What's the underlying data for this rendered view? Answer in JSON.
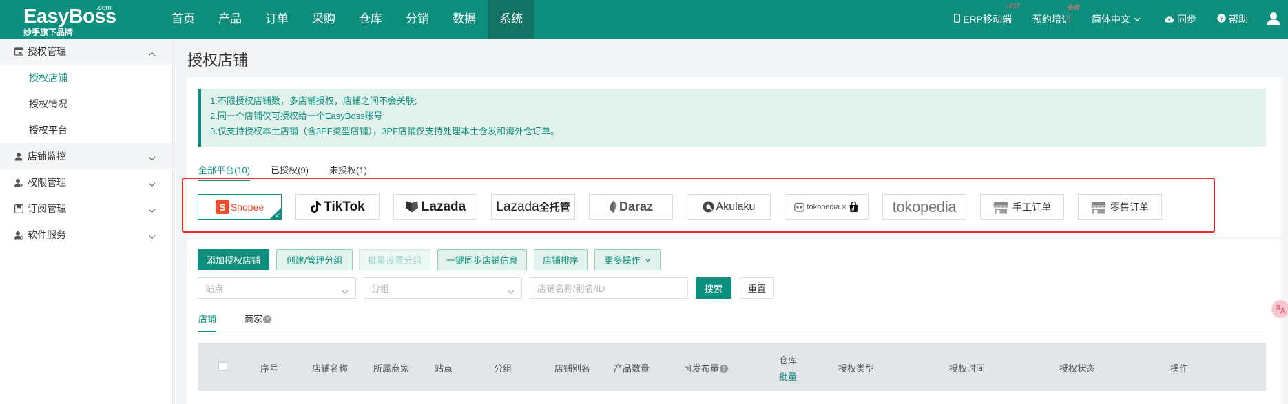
{
  "brand": {
    "name": "EasyBoss",
    "com": ".com",
    "tagline": "妙手旗下品牌"
  },
  "nav": [
    "首页",
    "产品",
    "订单",
    "采购",
    "仓库",
    "分销",
    "数据",
    "系统"
  ],
  "nav_active": "系统",
  "top_right": {
    "erp_label": "ERP移动端",
    "erp_badge": "HOT",
    "training_label": "预约培训",
    "training_badge": "免费",
    "lang_label": "简体中文",
    "sync_label": "同步",
    "help_label": "帮助"
  },
  "sidebar": {
    "groups": [
      {
        "label": "授权管理",
        "children": [
          "授权店铺",
          "授权情况",
          "授权平台"
        ]
      },
      {
        "label": "店铺监控"
      },
      {
        "label": "权限管理"
      },
      {
        "label": "订阅管理"
      },
      {
        "label": "软件服务"
      }
    ]
  },
  "page": {
    "title": "授权店铺"
  },
  "notice": [
    "1.不限授权店铺数，多店铺授权，店铺之间不会关联;",
    "2.同一个店铺仅可授权给一个EasyBoss账号;",
    "3.仅支持授权本土店铺（含3PF类型店铺），3PF店铺仅支持处理本土仓发和海外仓订单。"
  ],
  "platform_tabs": [
    "全部平台(10)",
    "已授权(9)",
    "未授权(1)"
  ],
  "platforms": {
    "shopee": "Shopee",
    "tiktok": "TikTok",
    "lazada": "Lazada",
    "lazada_full": "Lazada",
    "lazada_full_suffix": "全托管",
    "daraz": "Daraz",
    "akulaku": "Akulaku",
    "tokopedia_x": "tokopedia ×",
    "tokopedia": "tokopedia",
    "manual": "手工订单",
    "retail": "零售订单"
  },
  "toolbar": {
    "add": "添加授权店铺",
    "manage_group": "创建/管理分组",
    "batch_group": "批量设置分组",
    "sync_info": "一键同步店铺信息",
    "sort": "店铺排序",
    "more": "更多操作"
  },
  "filters": {
    "site_placeholder": "站点",
    "group_placeholder": "分组",
    "keyword_placeholder": "店铺名称/别名/ID",
    "search": "搜索",
    "reset": "重置"
  },
  "sub_tabs": [
    "店铺",
    "商家"
  ],
  "table": {
    "headers": {
      "no": "序号",
      "shop_name": "店铺名称",
      "merchant": "所属商家",
      "site": "站点",
      "group": "分组",
      "alias": "店铺别名",
      "product_count": "产品数量",
      "distributable": "可发布量",
      "warehouse": "仓库",
      "warehouse_batch": "批量",
      "auth_type": "授权类型",
      "auth_time": "授权时间",
      "auth_status": "授权状态",
      "ops": "操作"
    }
  },
  "colors": {
    "brand": "#0e8f7e",
    "highlight_box": "#e52b2b"
  }
}
